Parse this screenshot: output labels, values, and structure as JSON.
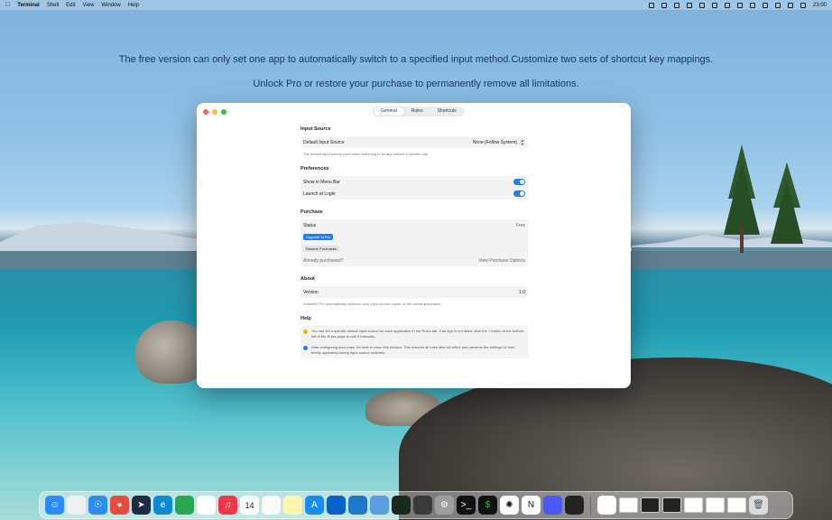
{
  "menubar": {
    "items": [
      "Terminal",
      "Shell",
      "Edit",
      "View",
      "Window",
      "Help"
    ],
    "clock": "23:00"
  },
  "banner": {
    "line1": "The free version can only set one app to automatically switch to a specified input method.Customize two sets of shortcut key mappings.",
    "line2": "Unlock Pro or restore your purchase to permanently remove all limitations."
  },
  "window": {
    "tabs": [
      "General",
      "Rules",
      "Shortcuts"
    ],
    "active_tab": "General",
    "input_source": {
      "title": "Input Source",
      "default_label": "Default Input Source",
      "default_value": "None (Follow System)",
      "note": "The default input source used when switching to an app without a specific rule."
    },
    "preferences": {
      "title": "Preferences",
      "show_menu_bar": "Show in Menu Bar",
      "launch_login": "Launch at Login"
    },
    "purchase": {
      "title": "Purchase",
      "status_label": "Status",
      "status_value": "Free",
      "upgrade": "Upgrade to Pro",
      "restore": "Restore Purchases",
      "already": "Already purchased?",
      "view_options": "View Purchase Options"
    },
    "about": {
      "title": "About",
      "version_label": "Version",
      "version_value": "1.0",
      "note": "AntiwiNX Pro automatically switches your input source based on the active application."
    },
    "help": {
      "title": "Help",
      "tip1": "You can set a specific default input source for each application in the Rules tab. If an app is not listed, click the + button at the bottom-left of the Rules page to add it manually.",
      "tip2": "After configuring your rules, it's best to close this window. This ensures all rules take full effect and prevents the settings UI from briefly appearing during input source switches."
    }
  },
  "dock": {
    "calendar_day": "14"
  },
  "colors": {
    "accent": "#1b7cf5",
    "banner_text": "#13385c"
  }
}
